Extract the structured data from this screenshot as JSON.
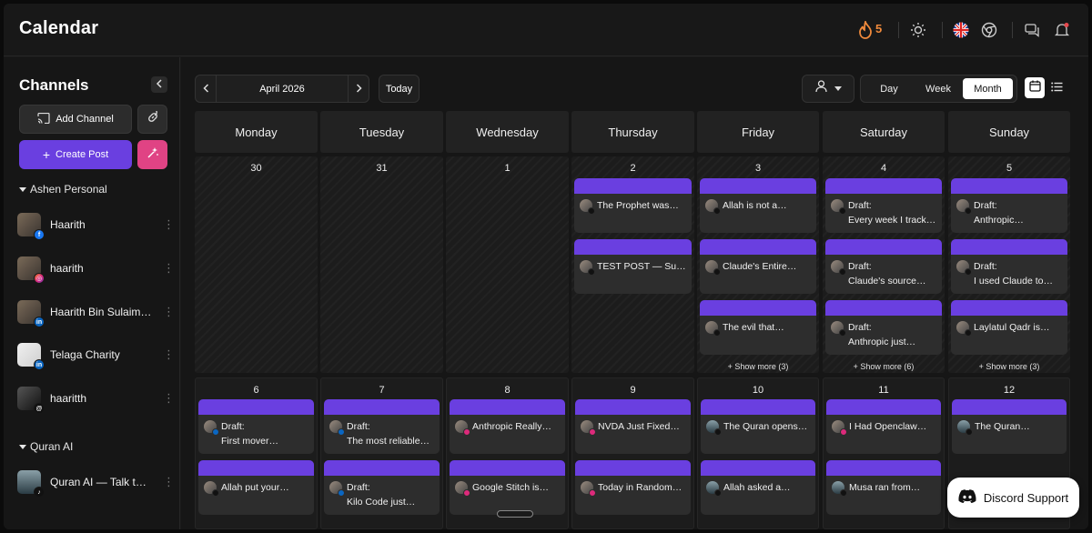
{
  "header": {
    "title": "Calendar",
    "streak_count": "5",
    "icons": [
      "flame-icon",
      "sun-icon",
      "uk-flag-icon",
      "chrome-icon",
      "chat-icon",
      "bell-icon"
    ]
  },
  "sidebar": {
    "title": "Channels",
    "add_channel_label": "Add Channel",
    "create_post_label": "Create Post",
    "groups": [
      {
        "label": "Ashen Personal",
        "channels": [
          {
            "name": "Haarith",
            "platform": "facebook"
          },
          {
            "name": "haarith",
            "platform": "instagram"
          },
          {
            "name": "Haarith Bin Sulaiman",
            "platform": "linkedin"
          },
          {
            "name": "Telaga Charity",
            "platform": "linkedin"
          },
          {
            "name": "haaritth",
            "platform": "threads"
          }
        ]
      },
      {
        "label": "Quran AI",
        "channels": [
          {
            "name": "Quran AI — Talk to the Quran",
            "platform": "tiktok"
          }
        ]
      }
    ]
  },
  "toolbar": {
    "month_label": "April 2026",
    "today_label": "Today",
    "views": [
      "Day",
      "Week",
      "Month"
    ],
    "active_view": "Month"
  },
  "calendar": {
    "weekdays": [
      "Monday",
      "Tuesday",
      "Wednesday",
      "Thursday",
      "Friday",
      "Saturday",
      "Sunday"
    ],
    "week1": {
      "days": [
        "30",
        "31",
        "1",
        "2",
        "3",
        "4",
        "5"
      ],
      "posts": {
        "thu": [
          "The Prophet was…",
          "TEST POST — Sura…"
        ],
        "fri": [
          "Allah is not a…",
          "Claude's Entire…",
          "The evil that…"
        ],
        "sat": [
          {
            "draft": "Draft:",
            "text": "Every week I track…"
          },
          {
            "draft": "Draft:",
            "text": "Claude's source…"
          },
          {
            "draft": "Draft:",
            "text": "Anthropic just…"
          }
        ],
        "sun": [
          {
            "draft": "Draft:",
            "text": "Anthropic…"
          },
          {
            "draft": "Draft:",
            "text": "I used Claude to…"
          },
          "Laylatul Qadr is…"
        ]
      },
      "show_more": {
        "fri": "+ Show more (3)",
        "sat": "+ Show more (6)",
        "sun": "+ Show more (3)"
      }
    },
    "week2": {
      "days": [
        "6",
        "7",
        "8",
        "9",
        "10",
        "11",
        "12"
      ],
      "posts": {
        "mon": [
          {
            "draft": "Draft:",
            "text": "First mover…"
          },
          "Allah put your…"
        ],
        "tue": [
          {
            "draft": "Draft:",
            "text": "The most reliable…"
          },
          {
            "draft": "Draft:",
            "text": "Kilo Code just…"
          }
        ],
        "wed": [
          "Anthropic Really…",
          "Google Stitch is…"
        ],
        "thu": [
          "NVDA Just Fixed…",
          "Today in Random…"
        ],
        "fri": [
          "The Quran opens…",
          "Allah asked a…"
        ],
        "sat": [
          "I Had Openclaw…",
          "Musa ran from…"
        ],
        "sun": [
          "The Quran…"
        ]
      }
    }
  },
  "support": {
    "label": "Discord Support"
  },
  "colors": {
    "accent": "#6a3fe0",
    "pink": "#e04384",
    "flame": "#f08a3c"
  }
}
